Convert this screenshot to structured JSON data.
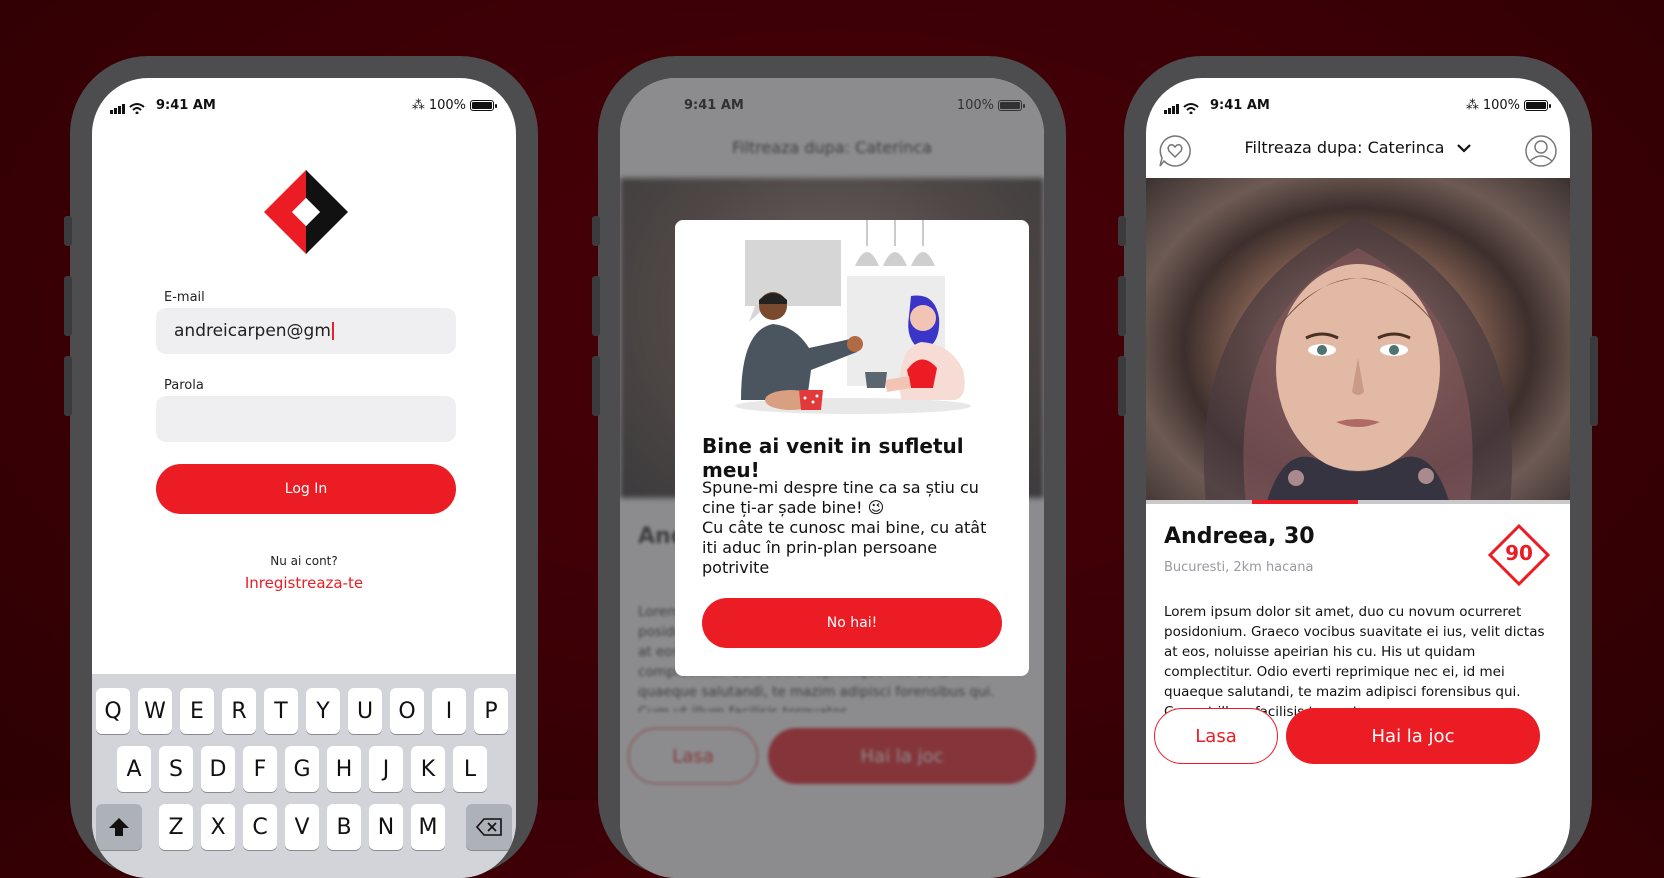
{
  "status_bar": {
    "time": "9:41 AM",
    "battery": "100%"
  },
  "login": {
    "email_label": "E-mail",
    "email_value": "andreicarpen@gm",
    "password_label": "Parola",
    "login_button": "Log In",
    "no_account_text": "Nu ai cont?",
    "register_link": "Inregistreaza-te",
    "keyboard_row1": [
      "Q",
      "W",
      "E",
      "R",
      "T",
      "Y",
      "U",
      "O",
      "I",
      "P"
    ],
    "keyboard_row2": [
      "A",
      "S",
      "D",
      "F",
      "G",
      "H",
      "J",
      "K",
      "L"
    ],
    "keyboard_row3": [
      "Z",
      "X",
      "C",
      "V",
      "B",
      "N",
      "M"
    ]
  },
  "welcome_modal": {
    "title": "Bine ai venit in sufletul meu!",
    "body": "Spune-mi despre tine ca sa știu cu cine ți-ar șade bine! 😉\nCu câte te cunosc mai bine, cu atât iti aduc în prin-plan persoane potrivite",
    "button": "No hai!"
  },
  "profile": {
    "filter_label": "Filtreaza dupa: Caterinca",
    "name": "Andreea, 30",
    "location": "Bucuresti, 2km hacana",
    "score": "90",
    "photo_progress": 0.25,
    "bio": "Lorem ipsum dolor sit amet, duo cu novum ocurreret posidonium. Graeco vocibus suavitate ei ius, velit dictas at eos, noluisse apeirian his cu. His ut quidam complectitur. Odio everti reprimique nec ei, id mei quaeque salutandi, te mazim adipisci forensibus qui. Cum ut illum facilisis torquatos.",
    "decline_button": "Lasa",
    "accept_button": "Hai la joc"
  },
  "colors": {
    "accent": "#ec1c24",
    "background": "#3a0005",
    "phone_frame": "#4d4d4f"
  }
}
